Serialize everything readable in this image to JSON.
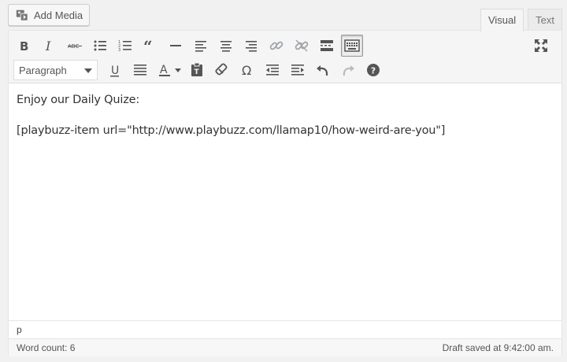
{
  "header": {
    "add_media_label": "Add Media",
    "add_media_icon": "media-icon"
  },
  "tabs": [
    {
      "label": "Visual",
      "active": true
    },
    {
      "label": "Text",
      "active": false
    }
  ],
  "toolbar": {
    "row1_icons": [
      "bold-icon",
      "italic-icon",
      "strikethrough-icon",
      "bulleted-list-icon",
      "numbered-list-icon",
      "blockquote-icon",
      "horizontal-line-icon",
      "align-left-icon",
      "align-center-icon",
      "align-right-icon",
      "insert-link-icon",
      "remove-link-icon",
      "read-more-icon",
      "toolbar-toggle-icon"
    ],
    "row2_icons": [
      "underline-icon",
      "justify-icon",
      "text-color-icon",
      "paste-as-text-icon",
      "clear-formatting-icon",
      "special-character-icon",
      "outdent-icon",
      "indent-icon",
      "undo-icon",
      "redo-icon",
      "help-icon"
    ],
    "format_select": {
      "value": "Paragraph"
    },
    "fullscreen_icon": "fullscreen-icon"
  },
  "content": {
    "line1": "Enjoy our Daily Quize:",
    "line2": "[playbuzz-item url=\"http://www.playbuzz.com/llamap10/how-weird-are-you\"]"
  },
  "path": "p",
  "status": {
    "word_count": "Word count: 6",
    "draft_saved": "Draft saved at 9:42:00 am."
  },
  "colors": {
    "icon": "#555555",
    "disabled": "#a0a5aa",
    "border": "#e5e5e5"
  }
}
